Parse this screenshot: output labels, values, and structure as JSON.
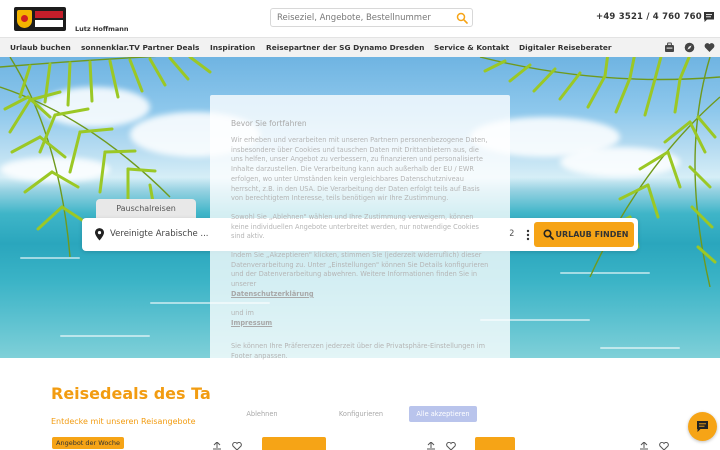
{
  "header": {
    "agent_name": "Lutz Hoffmann",
    "search_placeholder": "Reiseziel, Angebote, Bestellnummer",
    "phone": "+49 3521 / 4 760 760",
    "icons": [
      "search-icon",
      "chat-icon"
    ]
  },
  "nav": {
    "items": [
      "Urlaub buchen",
      "sonnenklar.TV Partner Deals",
      "Inspiration",
      "Reisepartner der SG Dynamo Dresden",
      "Service & Kontakt",
      "Digitaler Reiseberater"
    ],
    "icons": [
      "suitcase-icon",
      "compass-icon",
      "heart-icon"
    ]
  },
  "hero": {
    "tab_label": "Pauschalreisen",
    "destination": "Vereinigte Arabische ...",
    "travelers": "2",
    "search_button": "URLAUB FINDEN"
  },
  "deals": {
    "title": "Reisedeals des Ta",
    "subtitle": "Entdecke mit unseren Reisangebote",
    "badge": "Angebot der Woche"
  },
  "consent": {
    "title": "Bevor Sie fortfahren",
    "paragraph1": "Wir erheben und verarbeiten mit unseren Partnern personenbezogene Daten, insbesondere über Cookies und tauschen Daten mit Drittanbietern aus, die uns helfen, unser Angebot zu verbessern, zu finanzieren und personalisierte Inhalte darzustellen. Die Verarbeitung kann auch außerhalb der EU / EWR erfolgen, wo unter Umständen kein vergleichbares Datenschutzniveau herrscht, z.B. in den USA. Die Verarbeitung der Daten erfolgt teils auf Basis von berechtigtem Interesse, teils benötigen wir Ihre Zustimmung.",
    "paragraph2": "Sowohl Sie „Ablehnen\" wählen und Ihre Zustimmung verweigern, können keine individuellen Angebote unterbreitet werden, nur notwendige Cookies sind aktiv.",
    "paragraph3": "Indem Sie „Akzeptieren\" klicken, stimmen Sie (jederzeit widerruflich) dieser Datenverarbeitung zu. Unter „Einstellungen\" können Sie Details konfigurieren und der Datenverarbeitung abwehren. Weitere Informationen finden Sie in unserer",
    "privacy_link": "Datenschutzerklärung",
    "and_text": "und im",
    "imprint_link": "Impressum",
    "footer_note": "Sie können Ihre Präferenzen jederzeit über die Privatsphäre-Einstellungen im Footer anpassen.",
    "btn_reject": "Ablehnen",
    "btn_configure": "Konfigurieren",
    "btn_accept": "Alle akzeptieren"
  },
  "colors": {
    "accent": "#f6a416",
    "deals_title": "#f29c11",
    "accept_button": "#b9c4ec"
  }
}
